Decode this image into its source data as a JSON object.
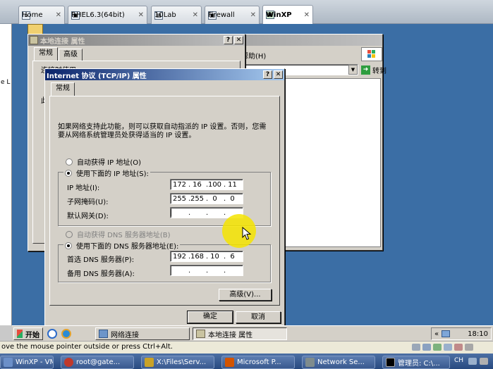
{
  "host_tabs": [
    {
      "label": "Home",
      "icon": "home-icon"
    },
    {
      "label": "RHEL6.3(64bit)",
      "icon": "vm-icon"
    },
    {
      "label": "10Lab",
      "icon": "folder-icon"
    },
    {
      "label": "Firewall",
      "icon": "vm-icon"
    },
    {
      "label": "WinXP",
      "icon": "vm-icon"
    }
  ],
  "close_glyph": "✕",
  "left_strip": {
    "frag1": "e L"
  },
  "back_window": {
    "title": "本地连接 属性",
    "help_btn": "?",
    "close_btn": "✕",
    "tabs": [
      "常规",
      "高级"
    ],
    "connect_label": "连接时使用:",
    "partial_label": "此"
  },
  "explorer": {
    "menu_help": "帮助(H)",
    "go_btn": "转到",
    "icon_char": "▼"
  },
  "dialog": {
    "title": "Internet 协议 (TCP/IP) 属性",
    "help_btn": "?",
    "close_btn": "✕",
    "tab": "常规",
    "description": "如果网络支持此功能，则可以获取自动指派的 IP 设置。否则，您需要从网络系统管理员处获得适当的 IP 设置。",
    "auto_ip": "自动获得 IP 地址(O)",
    "manual_ip": "使用下面的 IP 地址(S):",
    "ip_label": "IP 地址(I):",
    "ip": [
      "172",
      "16",
      "100",
      "11"
    ],
    "mask_label": "子网掩码(U):",
    "mask": [
      "255",
      "255",
      "0",
      "0"
    ],
    "gw_label": "默认网关(D):",
    "gw": [
      "",
      "",
      "",
      ""
    ],
    "auto_dns": "自动获得 DNS 服务器地址(B)",
    "manual_dns": "使用下面的 DNS 服务器地址(E):",
    "dns1_label": "首选 DNS 服务器(P):",
    "dns1": [
      "192",
      "168",
      "10",
      "6"
    ],
    "dns2_label": "备用 DNS 服务器(A):",
    "dns2": [
      "",
      "",
      "",
      ""
    ],
    "advanced_btn": "高级(V)...",
    "ok_btn": "确定",
    "cancel_btn": "取消",
    "selected_ip_mode": "manual",
    "selected_dns_mode": "manual"
  },
  "taskbar": {
    "start": "开始",
    "items": [
      {
        "label": "网络连接"
      },
      {
        "label": "本地连接 属性"
      }
    ],
    "tray_chevron": "«",
    "clock": "18:10"
  },
  "status_text": "ove the mouse pointer outside or press Ctrl+Alt.",
  "host_taskbar": [
    {
      "label": "WinXP - VM...",
      "color": "#6b8fc8"
    },
    {
      "label": "root@gate...",
      "color": "#c0392b"
    },
    {
      "label": "X:\\Files\\Serv...",
      "color": "#c9a227"
    },
    {
      "label": "Microsoft P...",
      "color": "#d35400"
    },
    {
      "label": "Network Se...",
      "color": "#7f8c8d"
    },
    {
      "label": "管理员: C:\\...",
      "color": "#000000"
    }
  ],
  "host_tray": {
    "lang": "CH"
  },
  "colors": {
    "desktop": "#3b6ea5",
    "active_title": "#0a246a",
    "cursor_highlight": "#f5e400"
  }
}
